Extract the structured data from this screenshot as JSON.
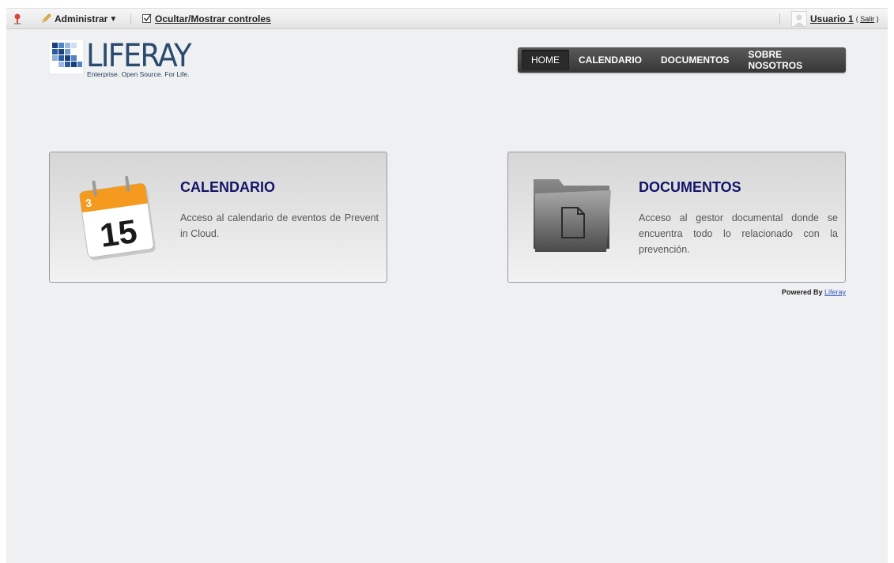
{
  "dockbar": {
    "admin_label": "Administrar",
    "admin_caret": "▼",
    "toggle_label": "Ocultar/Mostrar controles",
    "user_name": "Usuario 1",
    "salir_open": "(",
    "salir_label": "Salir",
    "salir_close": ")"
  },
  "logo": {
    "word": "LIFERAY",
    "tagline": "Enterprise. Open Source. For Life."
  },
  "nav": {
    "items": [
      {
        "label": "HOME"
      },
      {
        "label": "CALENDARIO"
      },
      {
        "label": "DOCUMENTOS"
      },
      {
        "label": "SOBRE NOSOTROS"
      }
    ]
  },
  "cards": [
    {
      "title": "CALENDARIO",
      "description": "Acceso al calendario de eventos de Prevent in Cloud.",
      "icon": "calendar-icon",
      "day": "15",
      "tab": "3"
    },
    {
      "title": "DOCUMENTOS",
      "description": "Acceso al gestor documental donde se encuentra todo lo relacionado con la prevención.",
      "icon": "folder-icon"
    }
  ],
  "footer": {
    "powered_by": "Powered By",
    "powered_link": "Liferay"
  },
  "colors": {
    "background": "#eff0f1",
    "title_blue": "#131468",
    "nav_dark": "#363636",
    "link_blue": "#3a5ec0"
  }
}
